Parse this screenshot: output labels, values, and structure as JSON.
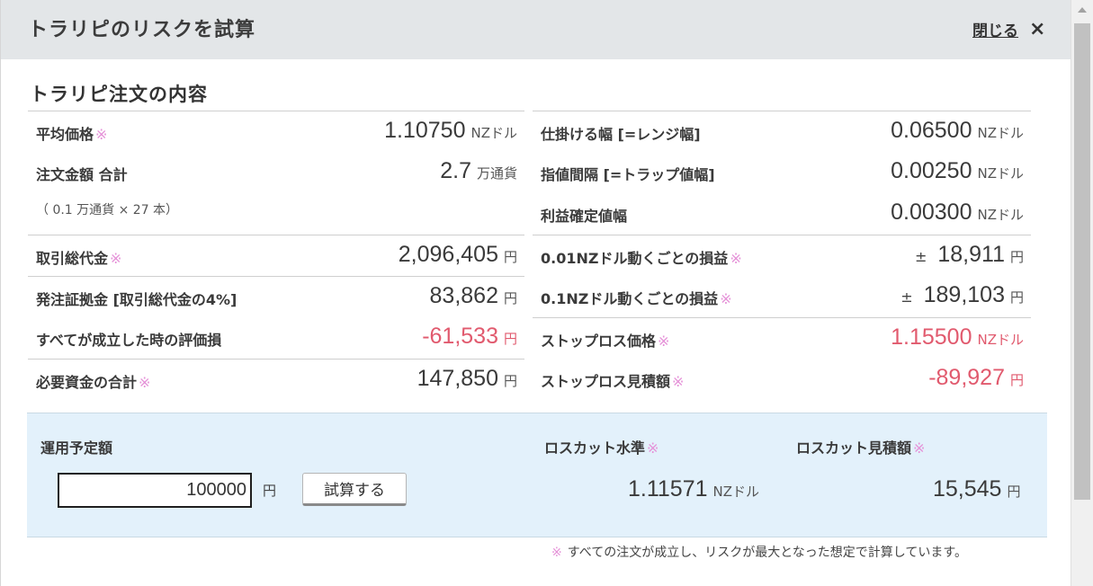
{
  "header": {
    "title": "トラリピのリスクを試算",
    "close_label": "閉じる",
    "close_icon": "×"
  },
  "section_title": "トラリピ注文の内容",
  "note_mark": "※",
  "left_rows": [
    {
      "label": "平均価格",
      "value": "1.10750",
      "unit": "NZドル"
    },
    {
      "label": "注文金額 合計",
      "value": "2.7",
      "unit": "万通貨"
    },
    {
      "label": "（ 0.1 万通貨 × 27 本）"
    },
    {
      "label": "取引総代金",
      "value": "2,096,405",
      "unit": "円"
    },
    {
      "label": "発注証拠金 [取引総代金の4%]",
      "value": "83,862",
      "unit": "円"
    },
    {
      "label": "すべてが成立した時の評価損",
      "value": "-61,533",
      "unit": "円"
    },
    {
      "label": "必要資金の合計",
      "value": "147,850",
      "unit": "円"
    }
  ],
  "right_rows": [
    {
      "label": "仕掛ける幅 [=レンジ幅]",
      "value": "0.06500",
      "unit": "NZドル"
    },
    {
      "label": "指値間隔 [=トラップ値幅]",
      "value": "0.00250",
      "unit": "NZドル"
    },
    {
      "label": "利益確定値幅",
      "value": "0.00300",
      "unit": "NZドル"
    },
    {
      "label": "0.01NZドル動くごとの損益",
      "prefix": "±",
      "value": "18,911",
      "unit": "円"
    },
    {
      "label": "0.1NZドル動くごとの損益",
      "prefix": "±",
      "value": "189,103",
      "unit": "円"
    },
    {
      "label": "ストップロス価格",
      "value": "1.15500",
      "unit": "NZドル"
    },
    {
      "label": "ストップロス見積額",
      "value": "-89,927",
      "unit": "円"
    }
  ],
  "bottom": {
    "plan_label": "運用予定額",
    "plan_value": "100000",
    "plan_unit": "円",
    "calc_button": "試算する",
    "losscut_level_label": "ロスカット水準",
    "losscut_level_value": "1.11571",
    "losscut_level_unit": "NZドル",
    "losscut_amount_label": "ロスカット見積額",
    "losscut_amount_value": "15,545",
    "losscut_amount_unit": "円"
  },
  "footnote": "すべての注文が成立し、リスクが最大となった想定で計算しています。",
  "colors": {
    "negative": "#e15a6e",
    "note_mark": "#e592d8",
    "header_bg": "#e3e6e8",
    "panel_bg": "#e3f1fb"
  }
}
